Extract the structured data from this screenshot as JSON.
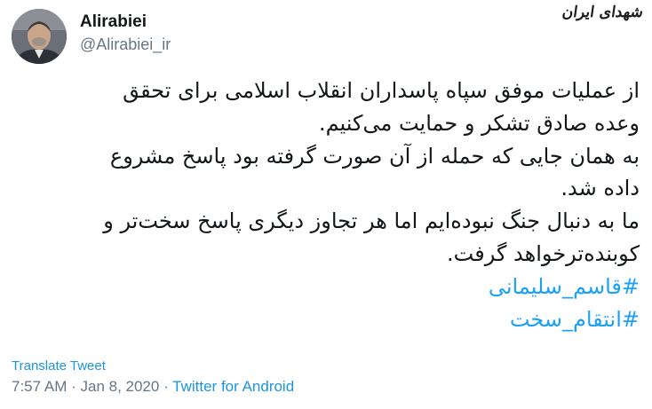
{
  "tweet": {
    "display_name": "Alirabiei",
    "handle": "@Alirabiei_ir",
    "watermark": "شهدای ایران",
    "lines": [
      "از عملیات موفق سپاه پاسداران انقلاب اسلامی برای تحقق",
      "وعده صادق تشکر و حمایت می‌کنیم.",
      "به همان جایی که حمله از آن صورت گرفته بود پاسخ مشروع",
      "داده شد.",
      "ما به دنبال جنگ نبوده‌ایم اما هر تجاوز دیگری پاسخ سخت‌تر و",
      "کوبنده‌ترخواهد گرفت."
    ],
    "hashtags": [
      "#قاسم_سلیمانی",
      "#انتقام_سخت"
    ],
    "translate_label": "Translate Tweet",
    "time": "7:57 AM",
    "separator": " · ",
    "date": "Jan 8, 2020",
    "source": "Twitter for Android"
  },
  "colors": {
    "link": "#1da1f2",
    "meta": "#657786",
    "text": "#14171a"
  }
}
